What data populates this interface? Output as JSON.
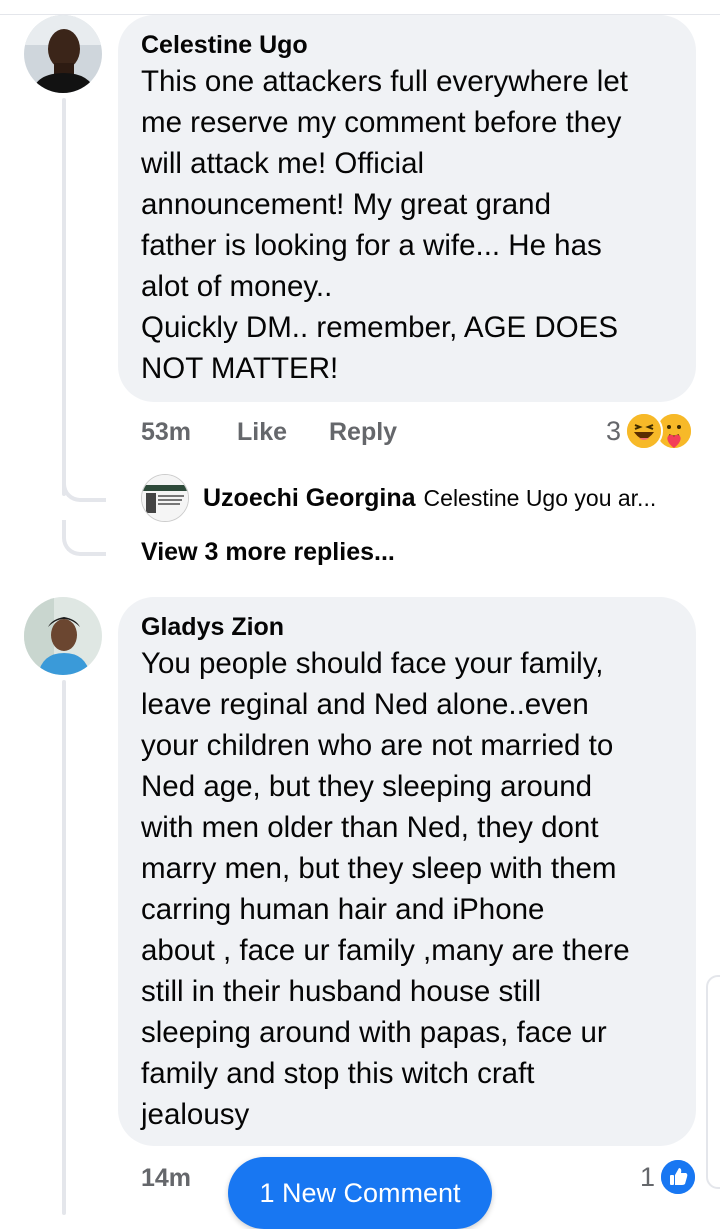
{
  "comments": [
    {
      "author": "Celestine Ugo",
      "text": "This one attackers full everywhere let\nme reserve my comment before they\nwill attack me! Official\nannouncement! My great grand\nfather is looking for a wife... He has\nalot of money..\nQuickly DM.. remember, AGE DOES\nNOT MATTER!",
      "time": "53m",
      "like_label": "Like",
      "reply_label": "Reply",
      "reaction_count": "3",
      "reactions": [
        "haha-emoji",
        "care-emoji"
      ],
      "reply_preview": {
        "author": "Uzoechi Georgina",
        "snippet": "Celestine Ugo you ar..."
      },
      "view_more": "View 3 more replies..."
    },
    {
      "author": "Gladys Zion",
      "text": "You people should face your family,\nleave reginal and Ned alone..even\nyour children who are not married to\nNed age, but they sleeping around\nwith men older than Ned, they dont\nmarry men, but they sleep with them\ncarring human hair and iPhone\nabout , face ur family ,many are there\nstill in their husband house still\nsleeping around with papas, face ur\nfamily and stop this witch craft\njealousy",
      "time": "14m",
      "reaction_count": "1",
      "reactions": [
        "like-emoji"
      ]
    }
  ],
  "new_comment_button": "1 New Comment",
  "colors": {
    "accent": "#1877f2",
    "bubble": "#f0f2f5",
    "meta_text": "#65676b",
    "thread_line": "#e4e6eb"
  }
}
